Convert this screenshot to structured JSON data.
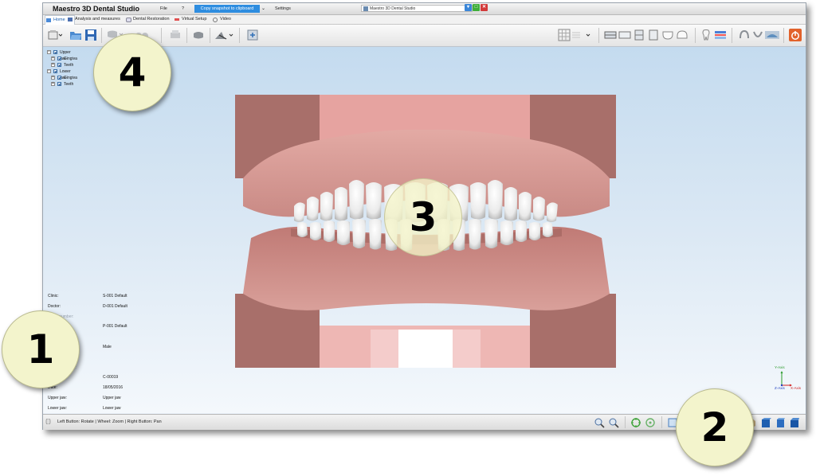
{
  "window": {
    "app_title": "Maestro 3D Dental Studio",
    "menu": {
      "file": "File",
      "help": "?",
      "copy_snapshot": "Copy snapshot to clipboard",
      "copy_caret": "⌄",
      "settings": "Settings"
    },
    "inner_title": "Maestro 3D Dental Studio"
  },
  "tabs": [
    {
      "label": "Home",
      "active": true
    },
    {
      "label": "Analysis and measures"
    },
    {
      "label": "Dental Restoration"
    },
    {
      "label": "Virtual Setup"
    },
    {
      "label": "Video"
    }
  ],
  "tree": [
    {
      "label": "Upper jaw",
      "level": 0
    },
    {
      "label": "Gingiva",
      "level": 1
    },
    {
      "label": "Teeth",
      "level": 1
    },
    {
      "label": "Lower jaw",
      "level": 0
    },
    {
      "label": "Gingiva",
      "level": 1
    },
    {
      "label": "Teeth",
      "level": 1
    }
  ],
  "info": [
    {
      "key": "Clinic:",
      "value": "S-001 Default",
      "dim": false
    },
    {
      "key": "Doctor:",
      "value": "D-001 Default",
      "dim": false
    },
    {
      "key": "Order number:",
      "value": "",
      "dim": true
    },
    {
      "key": "Patient:",
      "value": "P-001 Default",
      "dim": true
    },
    {
      "key": "Age:",
      "value": "",
      "dim": true
    },
    {
      "key": "Patient Sex:",
      "value": "Male",
      "dim": true
    },
    {
      "key": "Patient City:",
      "value": "",
      "dim": true
    },
    {
      "key": "Patient Country:",
      "value": "",
      "dim": true
    },
    {
      "key": "Case ID:",
      "value": "C-00019",
      "dim": true
    },
    {
      "key": "Date:",
      "value": "18/05/2016",
      "dim": false
    },
    {
      "key": "Upper jaw:",
      "value": "Upper jaw",
      "dim": false
    },
    {
      "key": "Lower jaw:",
      "value": "Lower jaw",
      "dim": false
    }
  ],
  "axes": {
    "y": "Y-Axis",
    "z": "Z-Axis",
    "x": "X-Axis"
  },
  "status": {
    "text": "Left Button: Rotate | Wheel: Zoom | Right Button: Pan"
  },
  "callouts": {
    "c1": "1",
    "c2": "2",
    "c3": "3",
    "c4": "4"
  },
  "colors": {
    "accent": "#2e8de0",
    "gum": "#d48f8a",
    "tooth": "#f2f2f2",
    "callout": "#f3f4cc"
  }
}
